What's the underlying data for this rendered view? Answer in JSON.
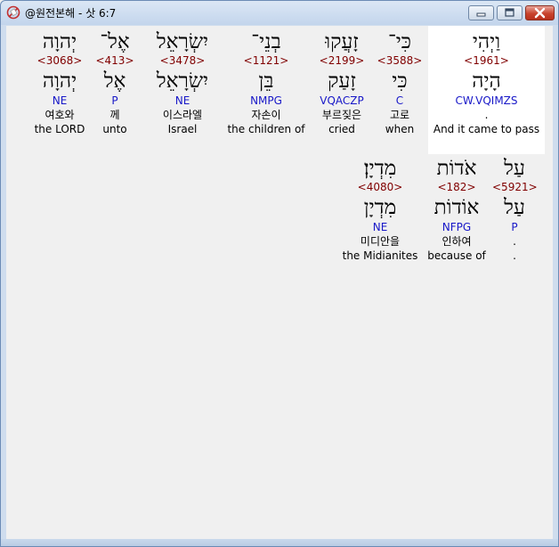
{
  "window": {
    "title": "@원전본해 - 삿 6:7",
    "minimize_label": "minimize",
    "maximize_label": "maximize",
    "close_label": "close"
  },
  "lines": [
    {
      "words": [
        {
          "heb": "יְהוָה",
          "strong": "<3068>",
          "lemma": "יְהוָה",
          "code": "NE",
          "kor": "여호와",
          "eng": "the LORD"
        },
        {
          "heb": "אֶל־",
          "strong": "<413>",
          "lemma": "אֶל",
          "code": "P",
          "kor": "께",
          "eng": "unto"
        },
        {
          "heb": "יִשְׂרָאֵל",
          "strong": "<3478>",
          "lemma": "יִשְׂרָאֵל",
          "code": "NE",
          "kor": "이스라엘",
          "eng": "Israel"
        },
        {
          "heb": "בְנֵי־",
          "strong": "<1121>",
          "lemma": "בֵּן",
          "code": "NMPG",
          "kor": "자손이",
          "eng": "the children of"
        },
        {
          "heb": "זָעֲקוּ",
          "strong": "<2199>",
          "lemma": "זָעַק",
          "code": "VQACZP",
          "kor": "부르짖은",
          "eng": "cried"
        },
        {
          "heb": "כִּי־",
          "strong": "<3588>",
          "lemma": "כִּי",
          "code": "C",
          "kor": "고로",
          "eng": "when"
        },
        {
          "heb": "וַיְהִי",
          "strong": "<1961>",
          "lemma": "הָיָה",
          "code": "CW.VQIMZS",
          "kor": ".",
          "eng": "And it came to pass"
        }
      ]
    },
    {
      "words": [
        {
          "heb": "מִדְיָן׃",
          "strong": "<4080>",
          "lemma": "מִדְיָן",
          "code": "NE",
          "kor": "미디안을",
          "eng": "the Midianites"
        },
        {
          "heb": "אֹדוֹת",
          "strong": "<182>",
          "lemma": "אוֹדוֹת",
          "code": "NFPG",
          "kor": "인하여",
          "eng": "because of"
        },
        {
          "heb": "עַל",
          "strong": "<5921>",
          "lemma": "עַל",
          "code": "P",
          "kor": ".",
          "eng": "."
        }
      ]
    }
  ]
}
